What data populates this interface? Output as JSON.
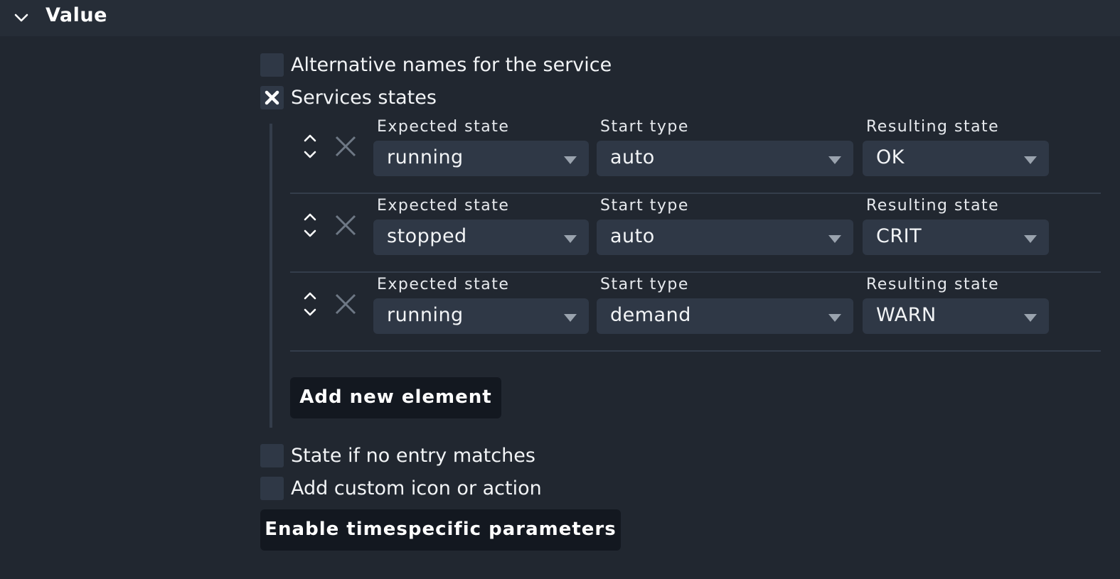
{
  "section": {
    "title": "Value"
  },
  "options": {
    "alt_names": {
      "label": "Alternative names for the service",
      "checked": false
    },
    "services_states": {
      "label": "Services states",
      "checked": true
    },
    "no_match": {
      "label": "State if no entry matches",
      "checked": false
    },
    "custom_icon": {
      "label": "Add custom icon or action",
      "checked": false
    }
  },
  "labels": {
    "expected_state": "Expected state",
    "start_type": "Start type",
    "resulting_state": "Resulting state"
  },
  "entries": [
    {
      "expected_state": "running",
      "start_type": "auto",
      "resulting_state": "OK"
    },
    {
      "expected_state": "stopped",
      "start_type": "auto",
      "resulting_state": "CRIT"
    },
    {
      "expected_state": "running",
      "start_type": "demand",
      "resulting_state": "WARN"
    }
  ],
  "buttons": {
    "add_new": "Add new element",
    "timespecific": "Enable timespecific parameters"
  },
  "icons": {
    "collapse": "chevron-down-icon",
    "checked": "x-check-icon",
    "reorder": "up-down-icon",
    "delete": "close-icon"
  }
}
